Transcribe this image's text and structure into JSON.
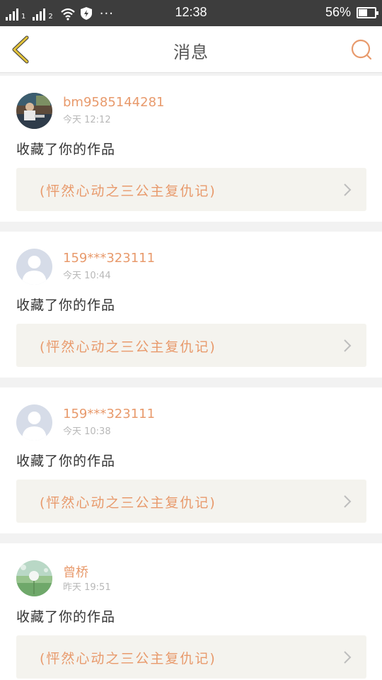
{
  "status_bar": {
    "sim1": "1",
    "sim2": "2",
    "dots": "···",
    "time": "12:38",
    "battery_percent_text": "56%",
    "battery_level": 0.56,
    "wifi_icon": "wifi-icon",
    "shield_icon": "shield-icon"
  },
  "nav": {
    "title": "消息",
    "back_icon": "chevron-left-icon",
    "search_icon": "search-icon",
    "accent_color": "#e89a6c",
    "back_color": "#e2c23a"
  },
  "messages": [
    {
      "user": "bm9585144281",
      "time": "今天 12:12",
      "action": "收藏了你的作品",
      "work": "(怦然心动之三公主复仇记)",
      "avatar": "photo-avatar-reading"
    },
    {
      "user": "159***323111",
      "time": "今天 10:44",
      "action": "收藏了你的作品",
      "work": "(怦然心动之三公主复仇记)",
      "avatar": "default-avatar"
    },
    {
      "user": "159***323111",
      "time": "今天 10:38",
      "action": "收藏了你的作品",
      "work": "(怦然心动之三公主复仇记)",
      "avatar": "default-avatar"
    },
    {
      "user": "曾桥",
      "time": "昨天 19:51",
      "action": "收藏了你的作品",
      "work": "(怦然心动之三公主复仇记)",
      "avatar": "photo-avatar-dandelion"
    }
  ]
}
